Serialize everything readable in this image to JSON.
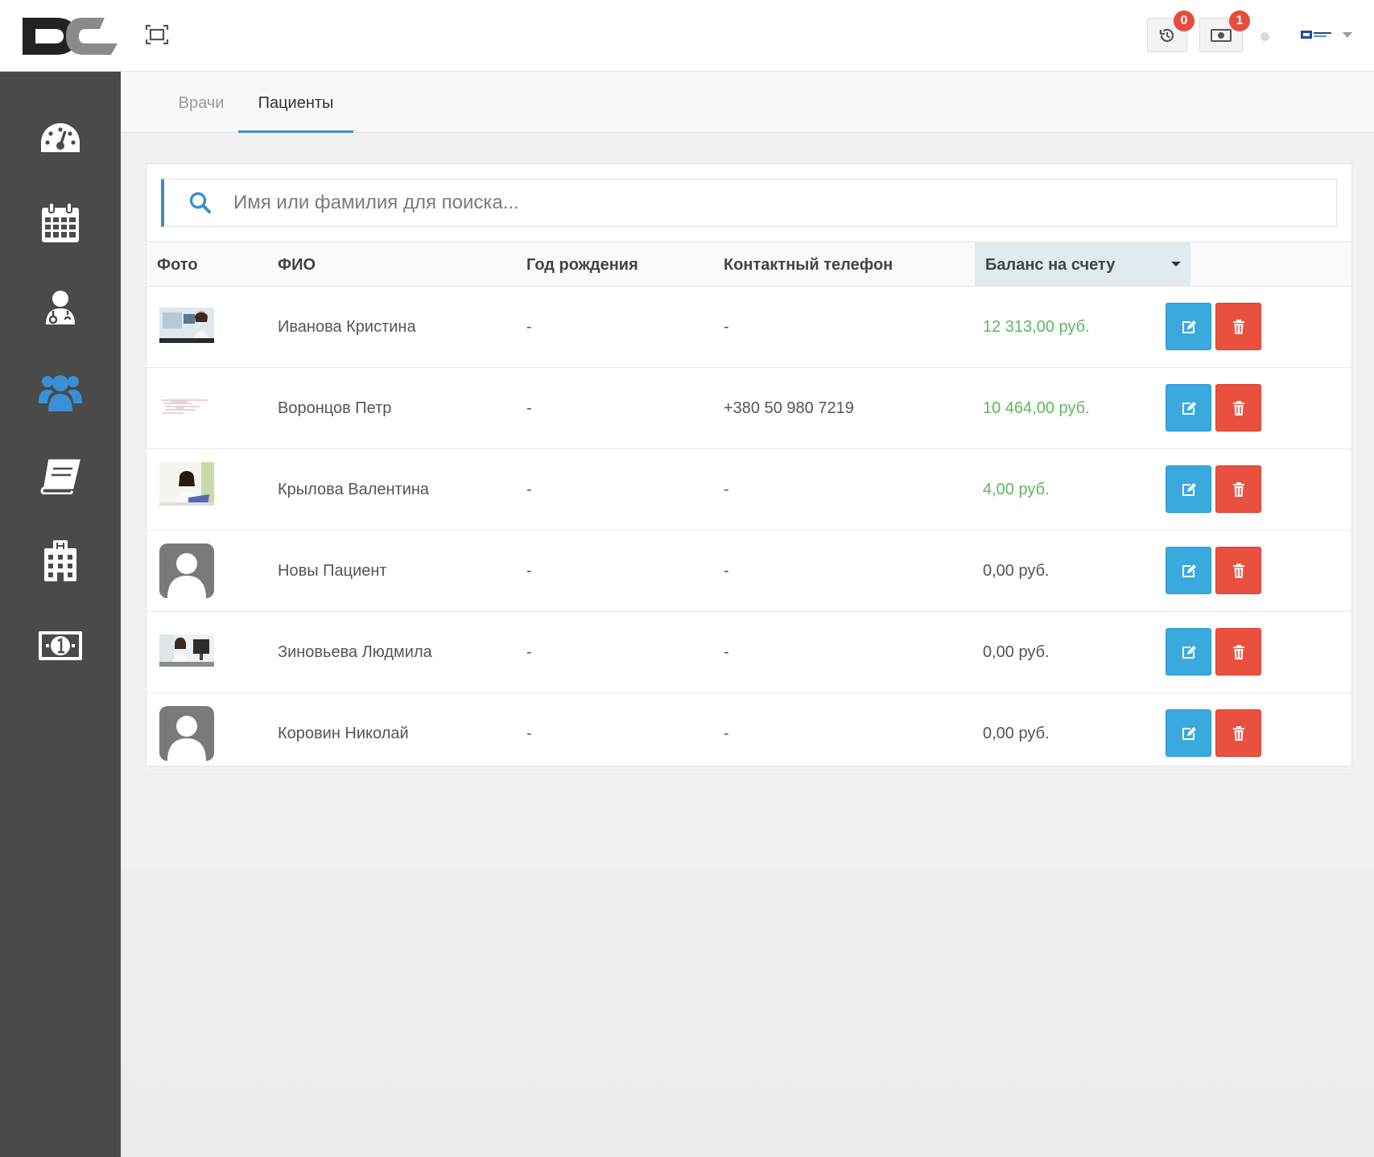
{
  "header": {
    "history_badge": "0",
    "payments_badge": "1"
  },
  "tabs": [
    {
      "label": "Врачи"
    },
    {
      "label": "Пациенты"
    }
  ],
  "search": {
    "placeholder": "Имя или фамилия для поиска..."
  },
  "table": {
    "columns": [
      "Фото",
      "ФИО",
      "Год рождения",
      "Контактный телефон",
      "Баланс на счету"
    ],
    "sorted_column": "Баланс на счету",
    "rows": [
      {
        "photo": "office-woman-photo",
        "name": "Иванова Кристина",
        "birth_year": "-",
        "phone": "-",
        "balance": "12 313,00 руб.",
        "positive": true
      },
      {
        "photo": "document-snippet-photo",
        "name": "Воронцов Петр",
        "birth_year": "-",
        "phone": "+380 50 980 7219",
        "balance": "10 464,00 руб.",
        "positive": true
      },
      {
        "photo": "woman-laptop-photo",
        "name": "Крылова Валентина",
        "birth_year": "-",
        "phone": "-",
        "balance": "4,00 руб.",
        "positive": true
      },
      {
        "photo": "default-avatar",
        "name": "Новы Пациент",
        "birth_year": "-",
        "phone": "-",
        "balance": "0,00 руб.",
        "positive": false
      },
      {
        "photo": "office-desk-photo",
        "name": "Зиновьева Людмила",
        "birth_year": "-",
        "phone": "-",
        "balance": "0,00 руб.",
        "positive": false
      },
      {
        "photo": "default-avatar",
        "name": "Коровин Николай",
        "birth_year": "-",
        "phone": "-",
        "balance": "0,00 руб.",
        "positive": false
      }
    ]
  },
  "sidebar": {
    "items": [
      {
        "icon": "dashboard-icon",
        "active": false
      },
      {
        "icon": "calendar-icon",
        "active": false
      },
      {
        "icon": "doctor-icon",
        "active": false
      },
      {
        "icon": "patients-icon",
        "active": true
      },
      {
        "icon": "book-icon",
        "active": false
      },
      {
        "icon": "clinic-icon",
        "active": false
      },
      {
        "icon": "money-icon",
        "active": false
      }
    ]
  },
  "colors": {
    "sidebar_bg": "#4a4a49",
    "accent": "#3a8fc9",
    "active_icon": "#3a8fd6",
    "positive_balance": "#5cb85c",
    "edit_button": "#3aa9dd",
    "delete_button": "#e9513e",
    "badge": "#e74c3c"
  }
}
